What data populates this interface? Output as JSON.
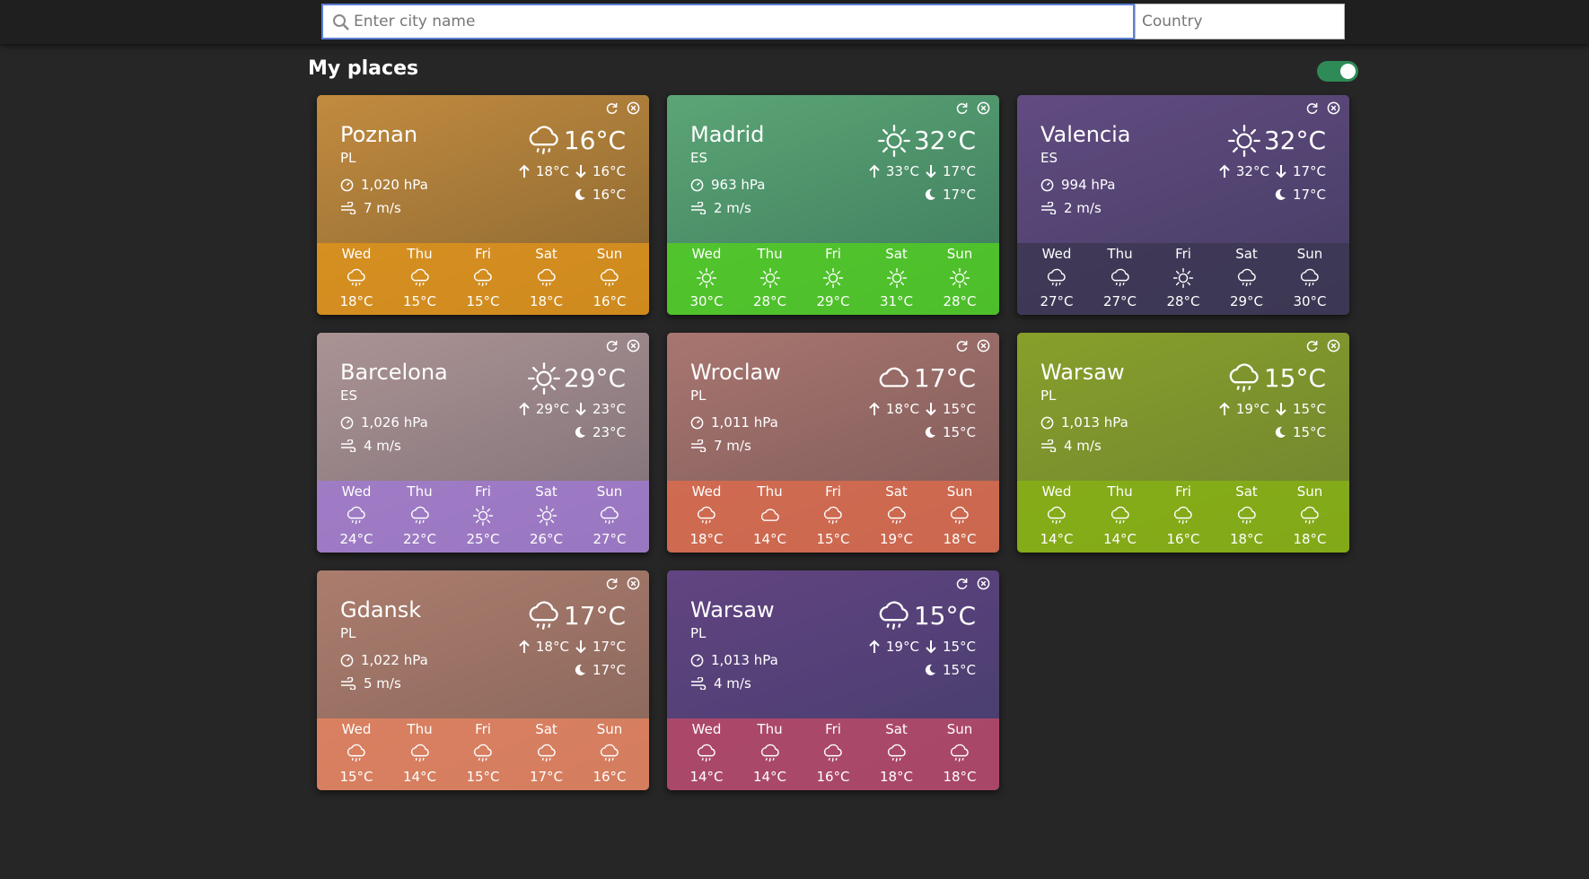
{
  "search": {
    "placeholder": "Enter city name",
    "value": "",
    "country_placeholder": "Country",
    "country_value": ""
  },
  "section": {
    "title": "My places",
    "toggle_on": true
  },
  "colors": {
    "toggle": "#2e8b57",
    "search_border": "#5b7fd6"
  },
  "cards": [
    {
      "city": "Poznan",
      "country": "PL",
      "icon": "rain-icon",
      "temp": "16°C",
      "max": "18°C",
      "min": "16°C",
      "night": "16°C",
      "pressure": "1,020 hPa",
      "wind": "7 m/s",
      "tint": "#c98a2a",
      "band": "#e3951a",
      "scene": "#b98c5a",
      "forecast": [
        {
          "day": "Wed",
          "icon": "rain-icon",
          "temp": "18°C"
        },
        {
          "day": "Thu",
          "icon": "rain-icon",
          "temp": "15°C"
        },
        {
          "day": "Fri",
          "icon": "rain-icon",
          "temp": "15°C"
        },
        {
          "day": "Sat",
          "icon": "rain-icon",
          "temp": "18°C"
        },
        {
          "day": "Sun",
          "icon": "rain-icon",
          "temp": "16°C"
        }
      ]
    },
    {
      "city": "Madrid",
      "country": "ES",
      "icon": "sun-icon",
      "temp": "32°C",
      "max": "33°C",
      "min": "17°C",
      "night": "17°C",
      "pressure": "963 hPa",
      "wind": "2 m/s",
      "tint": "#3fae7a",
      "band": "#52d21c",
      "scene": "#7d9a70",
      "forecast": [
        {
          "day": "Wed",
          "icon": "sun-icon",
          "temp": "30°C"
        },
        {
          "day": "Thu",
          "icon": "sun-icon",
          "temp": "28°C"
        },
        {
          "day": "Fri",
          "icon": "sun-icon",
          "temp": "29°C"
        },
        {
          "day": "Sat",
          "icon": "sun-icon",
          "temp": "31°C"
        },
        {
          "day": "Sun",
          "icon": "sun-icon",
          "temp": "28°C"
        }
      ]
    },
    {
      "city": "Valencia",
      "country": "ES",
      "icon": "sun-icon",
      "temp": "32°C",
      "max": "32°C",
      "min": "17°C",
      "night": "17°C",
      "pressure": "994 hPa",
      "wind": "2 m/s",
      "tint": "#4f3f86",
      "band": "#3a3650",
      "scene": "#7a5a7a",
      "forecast": [
        {
          "day": "Wed",
          "icon": "rain-icon",
          "temp": "27°C"
        },
        {
          "day": "Thu",
          "icon": "rain-icon",
          "temp": "27°C"
        },
        {
          "day": "Fri",
          "icon": "sun-icon",
          "temp": "28°C"
        },
        {
          "day": "Sat",
          "icon": "rain-icon",
          "temp": "29°C"
        },
        {
          "day": "Sun",
          "icon": "rain-icon",
          "temp": "30°C"
        }
      ]
    },
    {
      "city": "Barcelona",
      "country": "ES",
      "icon": "sun-icon",
      "temp": "29°C",
      "max": "29°C",
      "min": "23°C",
      "night": "23°C",
      "pressure": "1,026 hPa",
      "wind": "4 m/s",
      "tint": "#b59aa8",
      "band": "#a27ad6",
      "scene": "#a08a7c",
      "forecast": [
        {
          "day": "Wed",
          "icon": "rain-icon",
          "temp": "24°C"
        },
        {
          "day": "Thu",
          "icon": "rain-icon",
          "temp": "22°C"
        },
        {
          "day": "Fri",
          "icon": "sun-icon",
          "temp": "25°C"
        },
        {
          "day": "Sat",
          "icon": "sun-icon",
          "temp": "26°C"
        },
        {
          "day": "Sun",
          "icon": "rain-icon",
          "temp": "27°C"
        }
      ]
    },
    {
      "city": "Wroclaw",
      "country": "PL",
      "icon": "cloud-icon",
      "temp": "17°C",
      "max": "18°C",
      "min": "15°C",
      "night": "15°C",
      "pressure": "1,011 hPa",
      "wind": "7 m/s",
      "tint": "#b2736f",
      "band": "#e06b4b",
      "scene": "#9c7a72",
      "forecast": [
        {
          "day": "Wed",
          "icon": "rain-icon",
          "temp": "18°C"
        },
        {
          "day": "Thu",
          "icon": "cloud-icon",
          "temp": "14°C"
        },
        {
          "day": "Fri",
          "icon": "rain-icon",
          "temp": "15°C"
        },
        {
          "day": "Sat",
          "icon": "rain-icon",
          "temp": "19°C"
        },
        {
          "day": "Sun",
          "icon": "rain-icon",
          "temp": "18°C"
        }
      ]
    },
    {
      "city": "Warsaw",
      "country": "PL",
      "icon": "rain-icon",
      "temp": "15°C",
      "max": "19°C",
      "min": "15°C",
      "night": "15°C",
      "pressure": "1,013 hPa",
      "wind": "4 m/s",
      "tint": "#9bbf2a",
      "band": "#88b412",
      "scene": "#6f7a2c",
      "forecast": [
        {
          "day": "Wed",
          "icon": "rain-icon",
          "temp": "14°C"
        },
        {
          "day": "Thu",
          "icon": "rain-icon",
          "temp": "14°C"
        },
        {
          "day": "Fri",
          "icon": "rain-icon",
          "temp": "16°C"
        },
        {
          "day": "Sat",
          "icon": "rain-icon",
          "temp": "18°C"
        },
        {
          "day": "Sun",
          "icon": "rain-icon",
          "temp": "18°C"
        }
      ]
    },
    {
      "city": "Gdansk",
      "country": "PL",
      "icon": "rain-icon",
      "temp": "17°C",
      "max": "18°C",
      "min": "17°C",
      "night": "17°C",
      "pressure": "1,022 hPa",
      "wind": "5 m/s",
      "tint": "#c48976",
      "band": "#ea8460",
      "scene": "#8c6e62",
      "forecast": [
        {
          "day": "Wed",
          "icon": "rain-icon",
          "temp": "15°C"
        },
        {
          "day": "Thu",
          "icon": "rain-icon",
          "temp": "14°C"
        },
        {
          "day": "Fri",
          "icon": "rain-icon",
          "temp": "15°C"
        },
        {
          "day": "Sat",
          "icon": "rain-icon",
          "temp": "17°C"
        },
        {
          "day": "Sun",
          "icon": "rain-icon",
          "temp": "16°C"
        }
      ]
    },
    {
      "city": "Warsaw",
      "country": "PL",
      "icon": "rain-icon",
      "temp": "15°C",
      "max": "19°C",
      "min": "15°C",
      "night": "15°C",
      "pressure": "1,013 hPa",
      "wind": "4 m/s",
      "tint": "#4e3f96",
      "band": "#c44a66",
      "scene": "#7a4a6a",
      "forecast": [
        {
          "day": "Wed",
          "icon": "rain-icon",
          "temp": "14°C"
        },
        {
          "day": "Thu",
          "icon": "rain-icon",
          "temp": "14°C"
        },
        {
          "day": "Fri",
          "icon": "rain-icon",
          "temp": "16°C"
        },
        {
          "day": "Sat",
          "icon": "rain-icon",
          "temp": "18°C"
        },
        {
          "day": "Sun",
          "icon": "rain-icon",
          "temp": "18°C"
        }
      ]
    }
  ]
}
